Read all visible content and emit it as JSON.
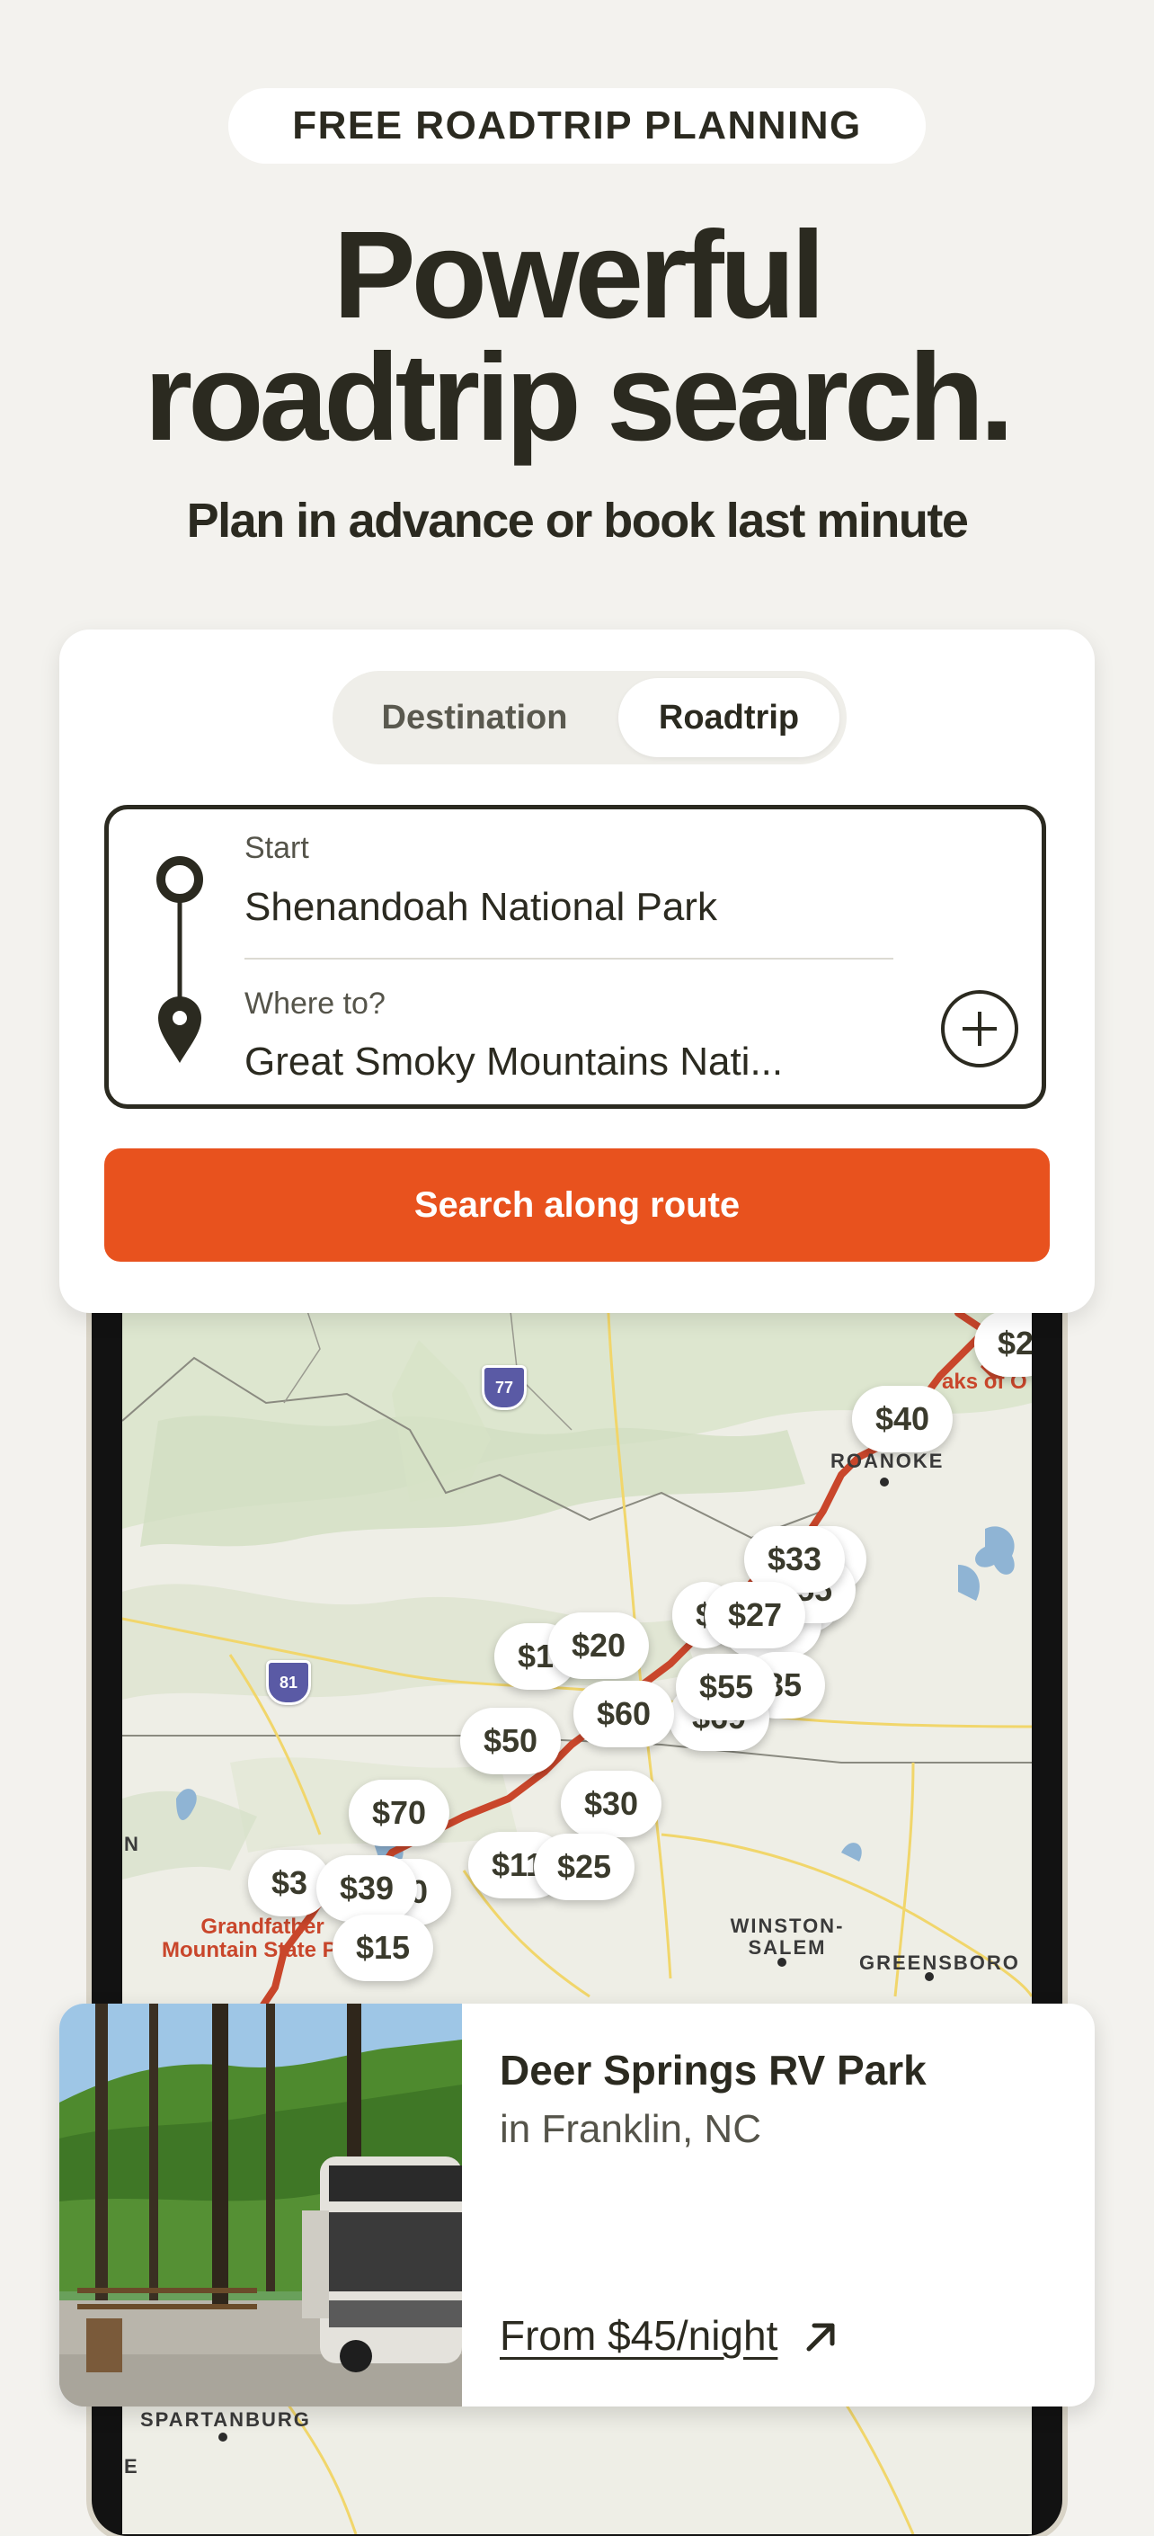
{
  "header": {
    "tag": "FREE ROADTRIP PLANNING",
    "headline_line1": "Powerful",
    "headline_line2": "roadtrip search.",
    "subhead": "Plan in advance or book last minute"
  },
  "search": {
    "tabs": [
      {
        "label": "Destination",
        "selected": false
      },
      {
        "label": "Roadtrip",
        "selected": true
      }
    ],
    "start_label": "Start",
    "start_value": "Shenandoah National Park",
    "end_label": "Where to?",
    "end_value": "Great Smoky Mountains Nati...",
    "button_label": "Search along route"
  },
  "map": {
    "prices": [
      "$2",
      "$40",
      "$33",
      "$55",
      "8",
      "$",
      "$27",
      "$20",
      "$1",
      "35",
      "$55",
      "$60",
      "$69",
      "$50",
      "$30",
      "$70",
      "$11",
      "$25",
      "$3",
      "$39",
      "40",
      "$15"
    ],
    "place_labels": [
      "ROANOKE",
      "WINSTON-SALEM",
      "GREENSBORO",
      "SPARTANBURG",
      "N",
      "E"
    ],
    "park_labels": [
      "aks of O",
      "Grandfather",
      "Mountain State P"
    ],
    "highway_shields": [
      "77",
      "81"
    ],
    "route_color": "#c9462b"
  },
  "listing": {
    "name": "Deer Springs RV Park",
    "location": "in Franklin, NC",
    "price": "From $45/night"
  },
  "colors": {
    "background": "#f3f2ee",
    "text": "#2b2a20",
    "accent": "#e8521e"
  }
}
